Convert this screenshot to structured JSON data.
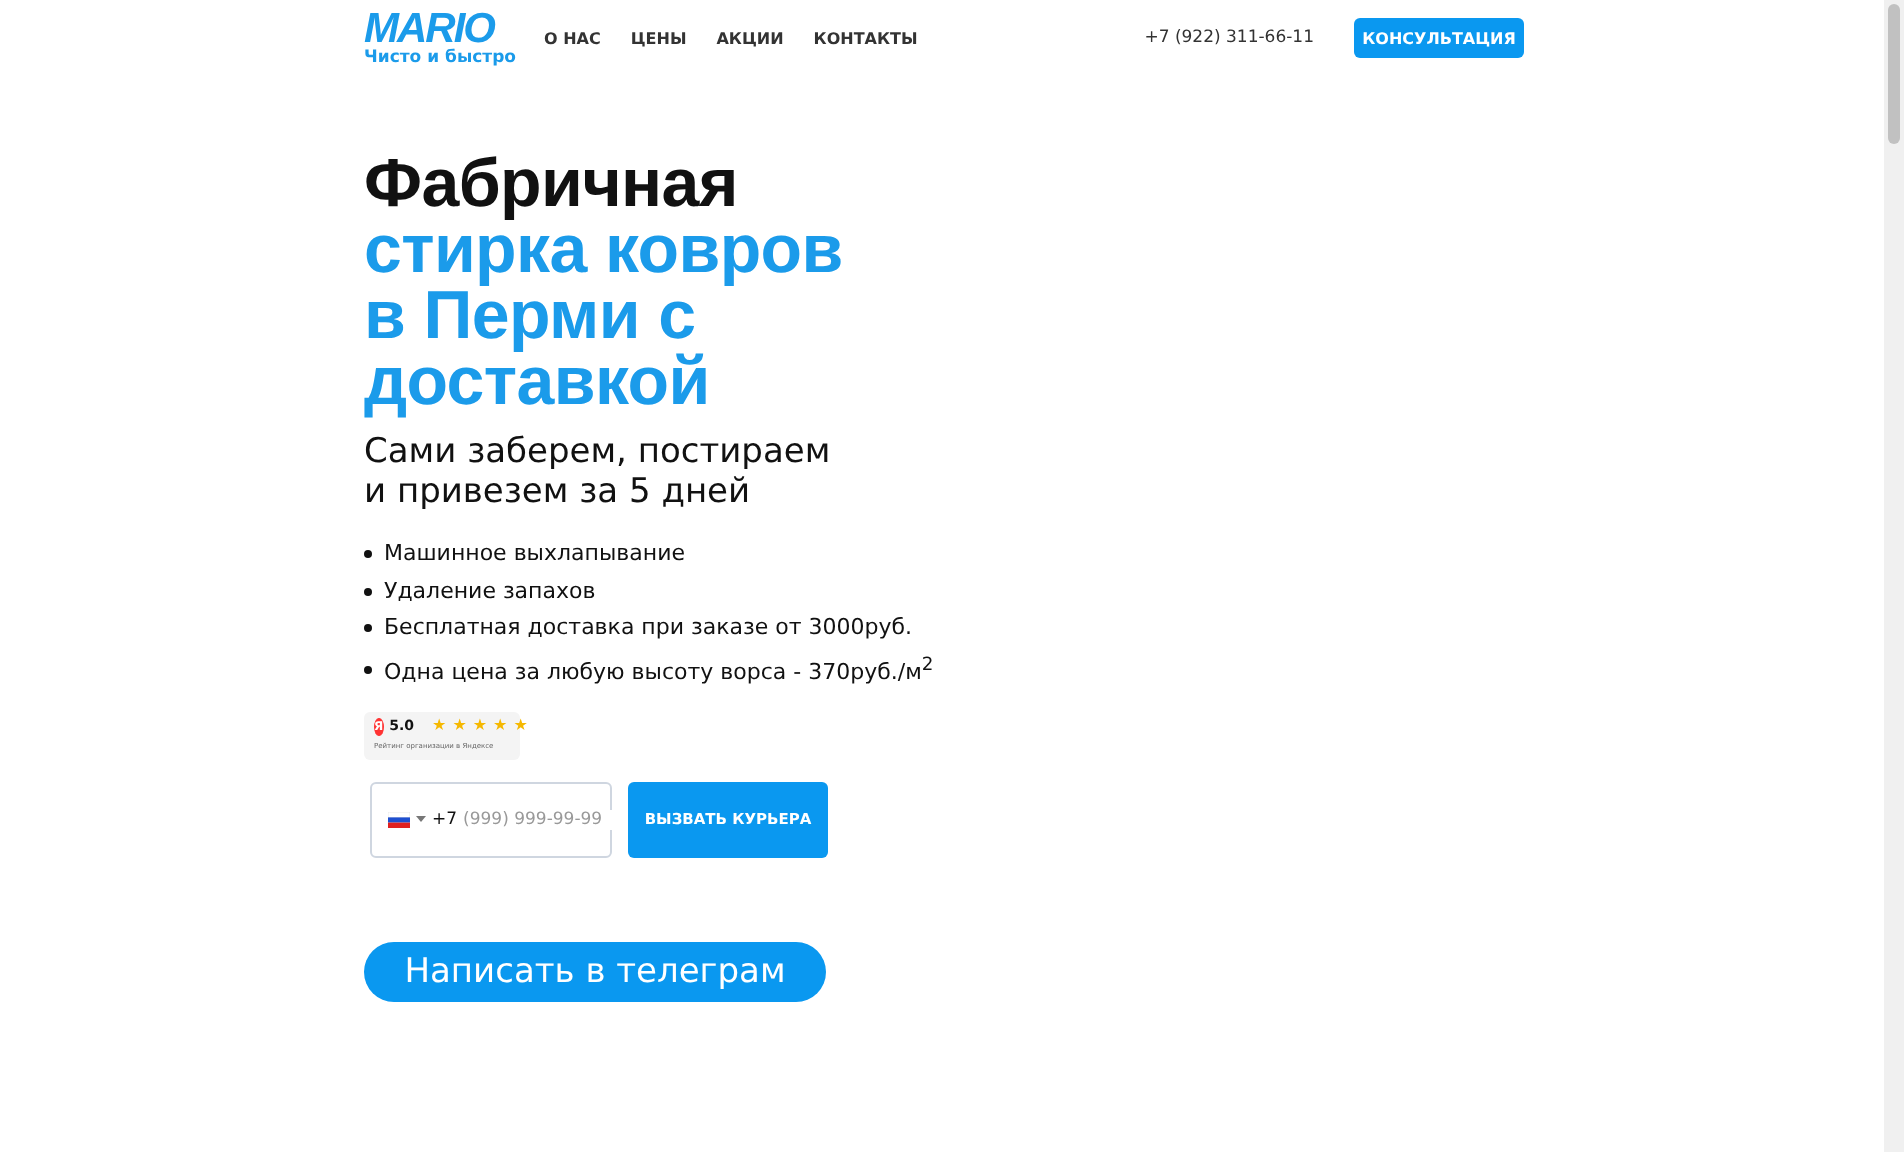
{
  "header": {
    "logo": {
      "name": "MARIO",
      "tagline": "Чисто и быстро"
    },
    "nav": [
      {
        "label": "О НАС"
      },
      {
        "label": "ЦЕНЫ"
      },
      {
        "label": "АКЦИИ"
      },
      {
        "label": "КОНТАКТЫ"
      }
    ],
    "phone": "+7 (922) 311-66-11",
    "cta": "КОНСУЛЬТАЦИЯ"
  },
  "hero": {
    "title_dark": "Фабричная",
    "title_accent": "стирка ковров в Перми с доставкой",
    "subtitle": [
      "Сами заберем, постираем",
      "и привезем за 5 дней"
    ],
    "features": [
      "Машинное выхлапывание",
      "Удаление запахов",
      "Бесплатная доставка при заказе от 3000руб.",
      "Одна цена за любую высоту ворса - 370руб./м$^{2}$"
    ],
    "rating": {
      "badge": "Я",
      "score": "5.0",
      "stars": 5,
      "caption": "Рейтинг организации в Яндексе"
    },
    "phone_form": {
      "code": "+7",
      "placeholder": "(999) 999-99-99",
      "button": "ВЫЗВАТЬ КУРЬЕРА"
    },
    "telegram_button": "Написать в телеграм"
  }
}
